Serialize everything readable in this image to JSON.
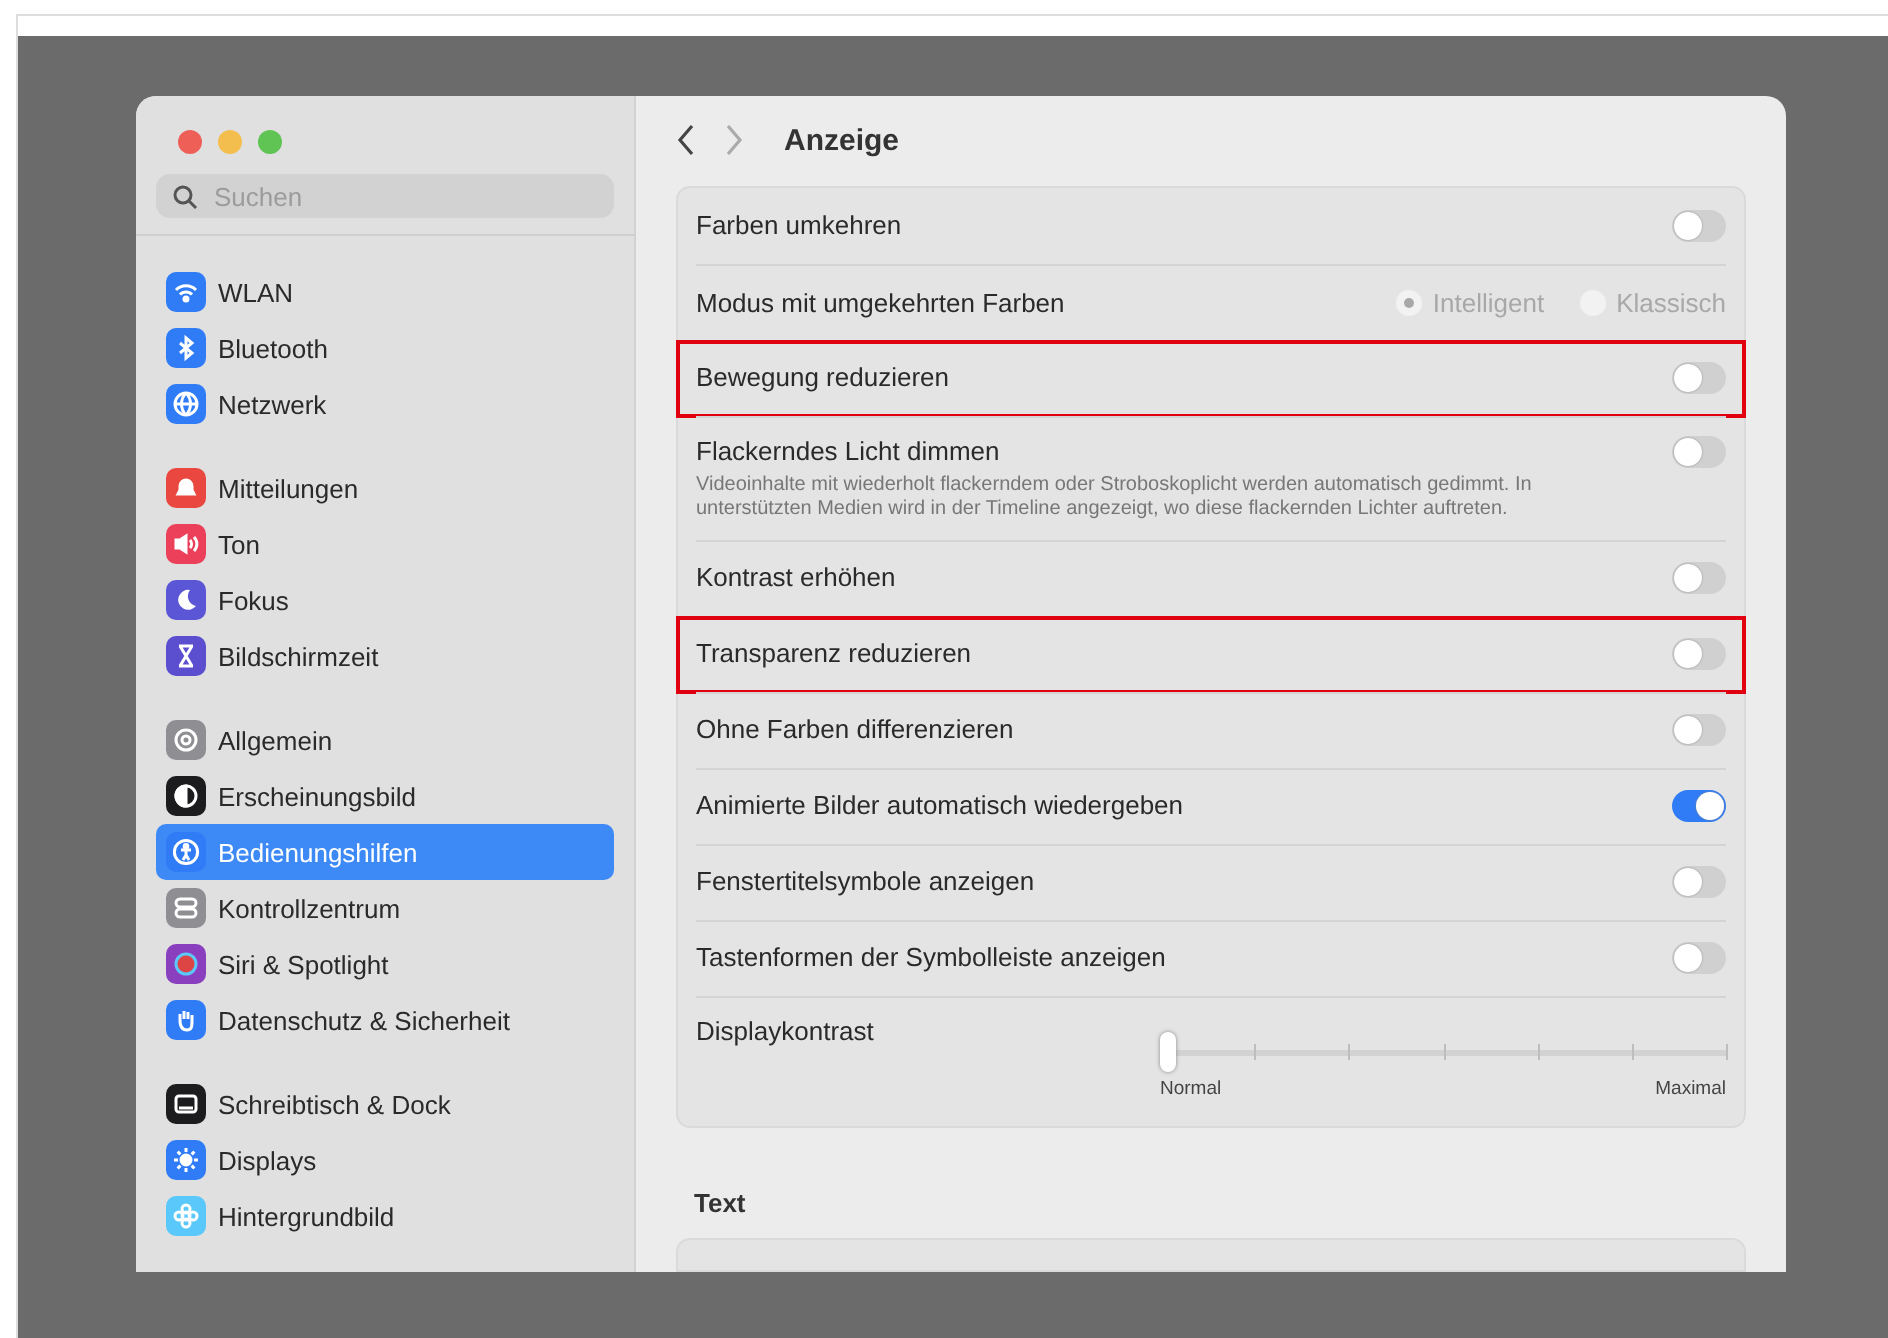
{
  "sidebar": {
    "search": {
      "placeholder": "Suchen"
    },
    "groups": [
      {
        "items": [
          {
            "label": "WLAN",
            "color": "#2f7cf6",
            "selected": false
          },
          {
            "label": "Bluetooth",
            "color": "#2f7cf6",
            "selected": false
          },
          {
            "label": "Netzwerk",
            "color": "#2f7cf6",
            "selected": false
          }
        ]
      },
      {
        "items": [
          {
            "label": "Mitteilungen",
            "color": "#e9473f",
            "selected": false
          },
          {
            "label": "Ton",
            "color": "#ec3f5a",
            "selected": false
          },
          {
            "label": "Fokus",
            "color": "#5b56d6",
            "selected": false
          },
          {
            "label": "Bildschirmzeit",
            "color": "#5b4fd0",
            "selected": false
          }
        ]
      },
      {
        "items": [
          {
            "label": "Allgemein",
            "color": "#8e8e93",
            "selected": false
          },
          {
            "label": "Erscheinungsbild",
            "color": "#1c1c1e",
            "selected": false
          },
          {
            "label": "Bedienungshilfen",
            "color": "#2f7cf6",
            "selected": true
          },
          {
            "label": "Kontrollzentrum",
            "color": "#8e8e93",
            "selected": false
          },
          {
            "label": "Siri & Spotlight",
            "color": "#8a3fbf",
            "selected": false
          },
          {
            "label": "Datenschutz & Sicherheit",
            "color": "#2f7cf6",
            "selected": false
          }
        ]
      },
      {
        "items": [
          {
            "label": "Schreibtisch & Dock",
            "color": "#1c1c1e",
            "selected": false
          },
          {
            "label": "Displays",
            "color": "#2f7cf6",
            "selected": false
          },
          {
            "label": "Hintergrundbild",
            "color": "#5ac8fa",
            "selected": false
          }
        ]
      }
    ]
  },
  "header": {
    "title": "Anzeige"
  },
  "settings": [
    {
      "kind": "toggle",
      "label": "Farben umkehren",
      "on": false,
      "highlighted": false
    },
    {
      "kind": "radio",
      "label": "Modus mit umgekehrten Farben",
      "disabled": true,
      "highlighted": false,
      "options": [
        {
          "label": "Intelligent",
          "selected": true
        },
        {
          "label": "Klassisch",
          "selected": false
        }
      ]
    },
    {
      "kind": "toggle",
      "label": "Bewegung reduzieren",
      "on": false,
      "highlighted": true
    },
    {
      "kind": "toggle",
      "label": "Flackerndes Licht dimmen",
      "description": "Videoinhalte mit wiederholt flackerndem oder Stroboskoplicht werden automatisch gedimmt. In unterstützten Medien wird in der Timeline angezeigt, wo diese flackernden Lichter auftreten.",
      "on": false,
      "highlighted": false
    },
    {
      "kind": "toggle",
      "label": "Kontrast erhöhen",
      "on": false,
      "highlighted": false
    },
    {
      "kind": "toggle",
      "label": "Transparenz reduzieren",
      "on": false,
      "highlighted": true
    },
    {
      "kind": "toggle",
      "label": "Ohne Farben differenzieren",
      "on": false,
      "highlighted": false
    },
    {
      "kind": "toggle",
      "label": "Animierte Bilder automatisch wiedergeben",
      "on": true,
      "highlighted": false
    },
    {
      "kind": "toggle",
      "label": "Fenstertitelsymbole anzeigen",
      "on": false,
      "highlighted": false
    },
    {
      "kind": "toggle",
      "label": "Tastenformen der Symbolleiste anzeigen",
      "on": false,
      "highlighted": false
    },
    {
      "kind": "slider",
      "label": "Displaykontrast",
      "level": 0,
      "min_label": "Normal",
      "max_label": "Maximal"
    }
  ],
  "section": {
    "title": "Text"
  }
}
